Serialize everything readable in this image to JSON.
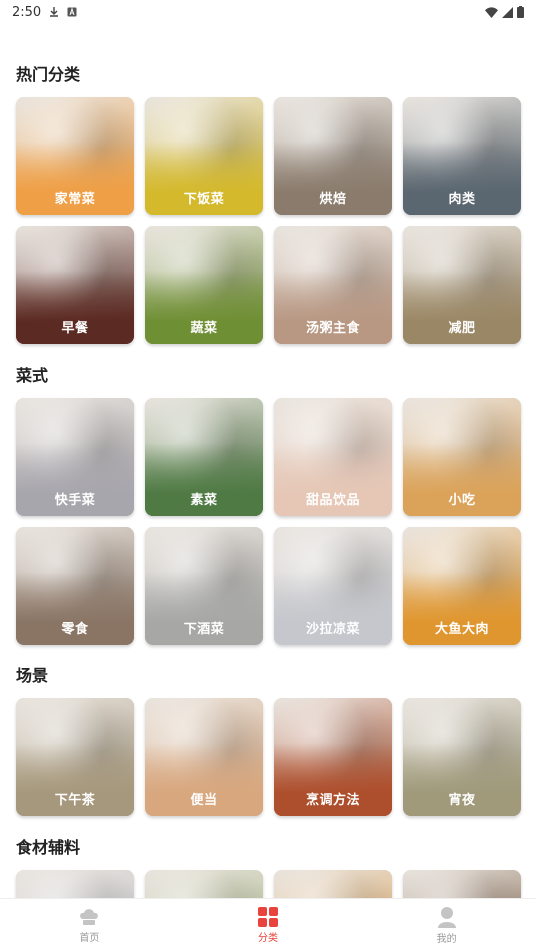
{
  "status_bar": {
    "time": "2:50"
  },
  "sections": [
    {
      "title": "热门分类",
      "items": [
        {
          "label": "家常菜",
          "color": "#ef9f45"
        },
        {
          "label": "下饭菜",
          "color": "#d4b92c"
        },
        {
          "label": "烘焙",
          "color": "#8a7b6c"
        },
        {
          "label": "肉类",
          "color": "#5a6670"
        },
        {
          "label": "早餐",
          "color": "#5b2a22"
        },
        {
          "label": "蔬菜",
          "color": "#6f8f34"
        },
        {
          "label": "汤粥主食",
          "color": "#b89883"
        },
        {
          "label": "减肥",
          "color": "#9a8765"
        }
      ]
    },
    {
      "title": "菜式",
      "items": [
        {
          "label": "快手菜",
          "color": "#a8a6ad"
        },
        {
          "label": "素菜",
          "color": "#4f7a44"
        },
        {
          "label": "甜品饮品",
          "color": "#e6c7b6"
        },
        {
          "label": "小吃",
          "color": "#dba35a"
        },
        {
          "label": "零食",
          "color": "#8a7565"
        },
        {
          "label": "下酒菜",
          "color": "#a7a8a6"
        },
        {
          "label": "沙拉凉菜",
          "color": "#c5c7cd"
        },
        {
          "label": "大鱼大肉",
          "color": "#e0962e"
        }
      ]
    },
    {
      "title": "场景",
      "items": [
        {
          "label": "下午茶",
          "color": "#a6987c"
        },
        {
          "label": "便当",
          "color": "#d8a77e"
        },
        {
          "label": "烹调方法",
          "color": "#ad4e2c"
        },
        {
          "label": "宵夜",
          "color": "#a09a7b"
        }
      ]
    },
    {
      "title": "食材辅料",
      "items": [
        {
          "label": "",
          "color": "#b9bcc4"
        },
        {
          "label": "",
          "color": "#9fb07a"
        },
        {
          "label": "",
          "color": "#d99a4a"
        },
        {
          "label": "",
          "color": "#6b4a2e"
        }
      ]
    }
  ],
  "tabs": [
    {
      "label": "首页",
      "icon": "chef-hat-icon"
    },
    {
      "label": "分类",
      "icon": "grid-icon"
    },
    {
      "label": "我的",
      "icon": "user-icon"
    }
  ],
  "active_tab_color": "#e8433c"
}
